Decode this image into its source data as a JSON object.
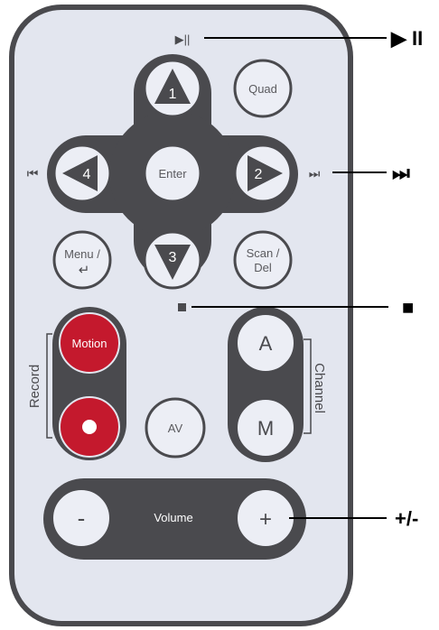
{
  "remote": {
    "play_pause_glyph": "▶||",
    "prev_glyph": "⏮",
    "next_glyph": "⏭",
    "stop_glyph": "■",
    "dpad": {
      "up": "1",
      "right": "2",
      "down": "3",
      "left": "4",
      "center": "Enter"
    },
    "quad": "Quad",
    "menu_line1": "Menu /",
    "menu_line2": "↵",
    "scan_line1": "Scan /",
    "scan_line2": "Del",
    "motion": "Motion",
    "record_label": "Record",
    "av": "AV",
    "channel_label": "Channel",
    "channel_a": "A",
    "channel_m": "M",
    "volume_label": "Volume",
    "volume_minus": "-",
    "volume_plus": "+"
  },
  "callouts": {
    "play_pause": "▶ II",
    "next": "⏭",
    "stop": "■",
    "volume": "+/-"
  },
  "colors": {
    "body_fill": "#e3e6ef",
    "body_stroke": "#4a4a4e",
    "dark_panel": "#4a4a4e",
    "button_fill": "#eceef5",
    "red": "#c4192d"
  }
}
